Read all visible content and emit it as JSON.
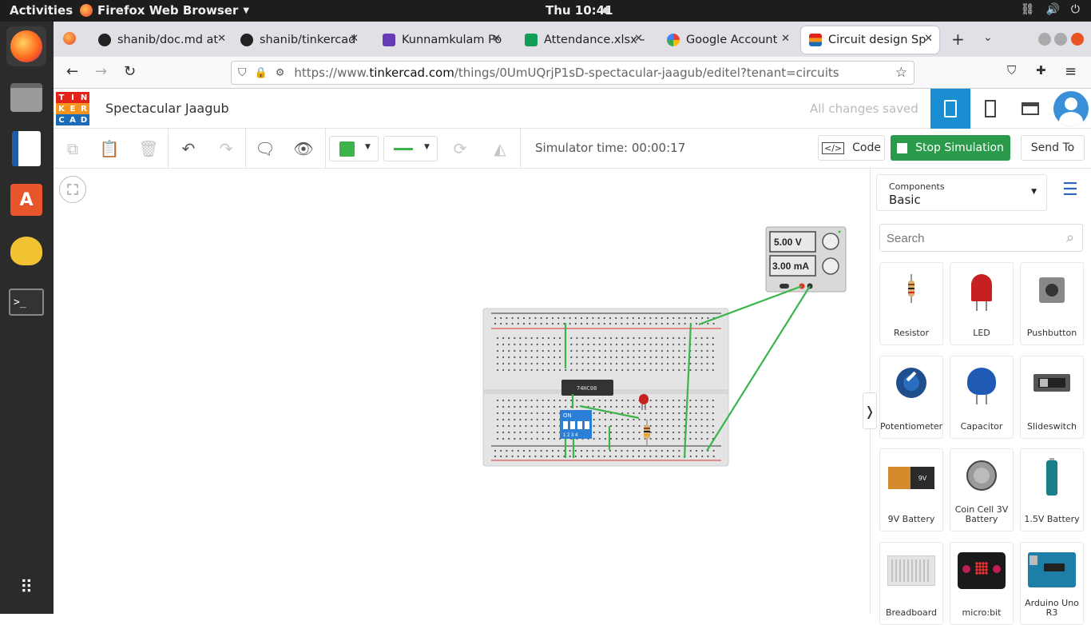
{
  "os": {
    "activities": "Activities",
    "app_name": "Firefox Web Browser",
    "clock": "Thu 10:41"
  },
  "tabs": [
    {
      "title": "shanib/doc.md at",
      "icon": "github-icon"
    },
    {
      "title": "shanib/tinkercad",
      "icon": "github-icon"
    },
    {
      "title": "Kunnamkulam Po",
      "icon": "forms-icon"
    },
    {
      "title": "Attendance.xlsx -",
      "icon": "sheets-icon"
    },
    {
      "title": "Google Account",
      "icon": "google-icon"
    },
    {
      "title": "Circuit design Sp",
      "icon": "tinkercad-icon"
    }
  ],
  "url": {
    "prefix": "https://www.",
    "domain": "tinkercad.com",
    "path": "/things/0UmUQrjP1sD-spectacular-jaagub/editel?tenant=circuits"
  },
  "tinkercad": {
    "logo_letters": [
      "T",
      "I",
      "N",
      "K",
      "E",
      "R",
      "C",
      "A",
      "D"
    ],
    "logo_colors": [
      "#e2231a",
      "#e2231a",
      "#e2231a",
      "#f7941d",
      "#f7941d",
      "#f7941d",
      "#1a6bb8",
      "#1a6bb8",
      "#1a6bb8"
    ],
    "project_title": "Spectacular Jaagub",
    "save_status": "All changes saved",
    "simulator_time": "Simulator time: 00:00:17",
    "code_label": "Code",
    "stop_label": "Stop Simulation",
    "send_label": "Send To",
    "accent": "#2b9a4b"
  },
  "circuit": {
    "voltage": "5.00 V",
    "current": "3.00 mA",
    "chip_label": "74HC08",
    "dip_label": "ON",
    "dip_numbers": "1 2 3 4"
  },
  "panel": {
    "dropdown_label": "Components",
    "dropdown_value": "Basic",
    "search_placeholder": "Search",
    "components": [
      {
        "label": "Resistor"
      },
      {
        "label": "LED"
      },
      {
        "label": "Pushbutton"
      },
      {
        "label": "Potentiometer"
      },
      {
        "label": "Capacitor"
      },
      {
        "label": "Slideswitch"
      },
      {
        "label": "9V Battery"
      },
      {
        "label": "Coin Cell 3V Battery"
      },
      {
        "label": "1.5V Battery"
      },
      {
        "label": "Breadboard"
      },
      {
        "label": "micro:bit"
      },
      {
        "label": "Arduino Uno R3"
      }
    ]
  }
}
